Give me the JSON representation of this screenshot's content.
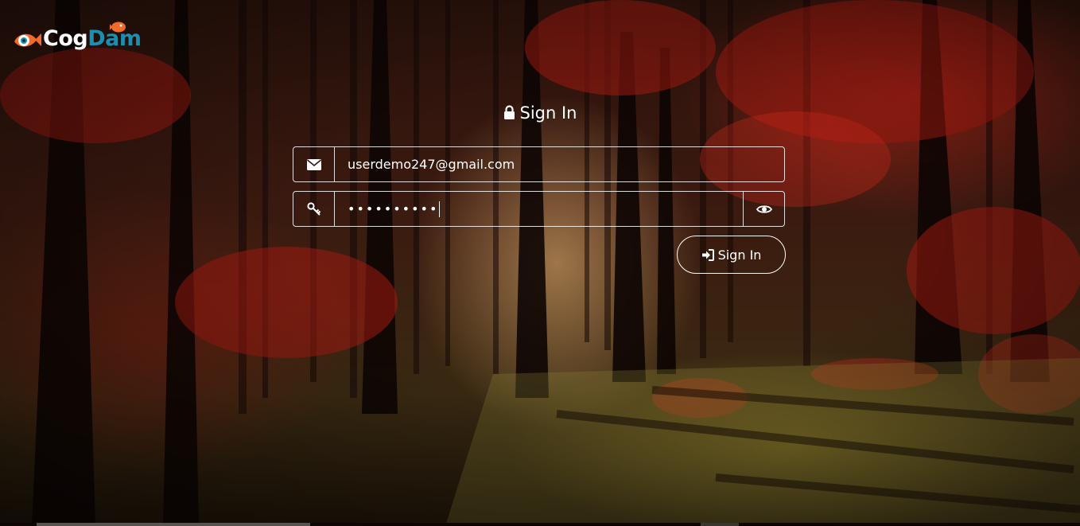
{
  "brand": {
    "logo_part1": "Cog",
    "logo_part2": "Dam",
    "colors": {
      "cog": "#ffffff",
      "dam": "#1b8fb0",
      "fish": "#f26a2a"
    }
  },
  "login": {
    "title": "Sign In",
    "email": {
      "icon": "envelope-icon",
      "value": "userdemo247@gmail.com"
    },
    "password": {
      "icon": "key-icon",
      "masked_value": "••••••••••",
      "toggle_icon": "eye-icon"
    },
    "submit_label": "Sign In",
    "submit_icon": "sign-in-icon"
  }
}
